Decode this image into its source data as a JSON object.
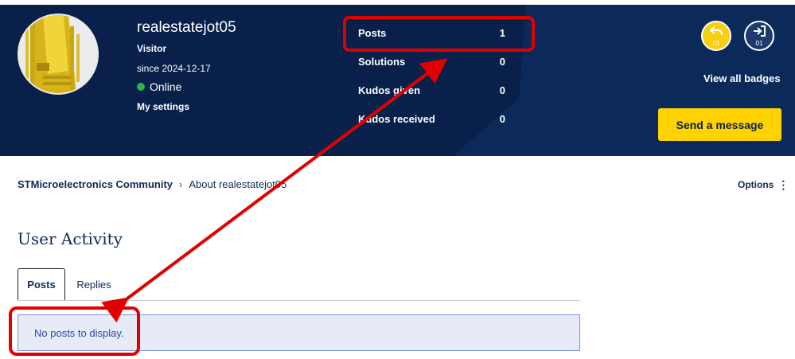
{
  "profile": {
    "username": "realestatejot05",
    "rank": "Visitor",
    "since": "since 2024-12-17",
    "status": "Online",
    "my_settings": "My settings"
  },
  "stats": [
    {
      "label": "Posts",
      "value": "1"
    },
    {
      "label": "Solutions",
      "value": "0"
    },
    {
      "label": "Kudos given",
      "value": "0"
    },
    {
      "label": "Kudos received",
      "value": "0"
    }
  ],
  "badges": {
    "items": [
      {
        "icon": "reply-arrow-icon",
        "count": "01",
        "color": "#f6cf10"
      },
      {
        "icon": "sign-in-icon",
        "count": "01",
        "color": "#1d3b6e"
      }
    ],
    "view_all_label": "View all badges"
  },
  "send_message_label": "Send a message",
  "breadcrumb": {
    "items": [
      "STMicroelectronics Community",
      "About realestatejot05"
    ],
    "separator": "›"
  },
  "options_label": "Options",
  "activity": {
    "title": "User Activity",
    "tabs": [
      {
        "label": "Posts",
        "active": true
      },
      {
        "label": "Replies",
        "active": false
      }
    ],
    "empty_message": "No posts to display."
  },
  "colors": {
    "header_bg": "#08204a",
    "accent_yellow": "#ffd200",
    "annotation_red": "#e10000",
    "online_green": "#28b44b"
  }
}
